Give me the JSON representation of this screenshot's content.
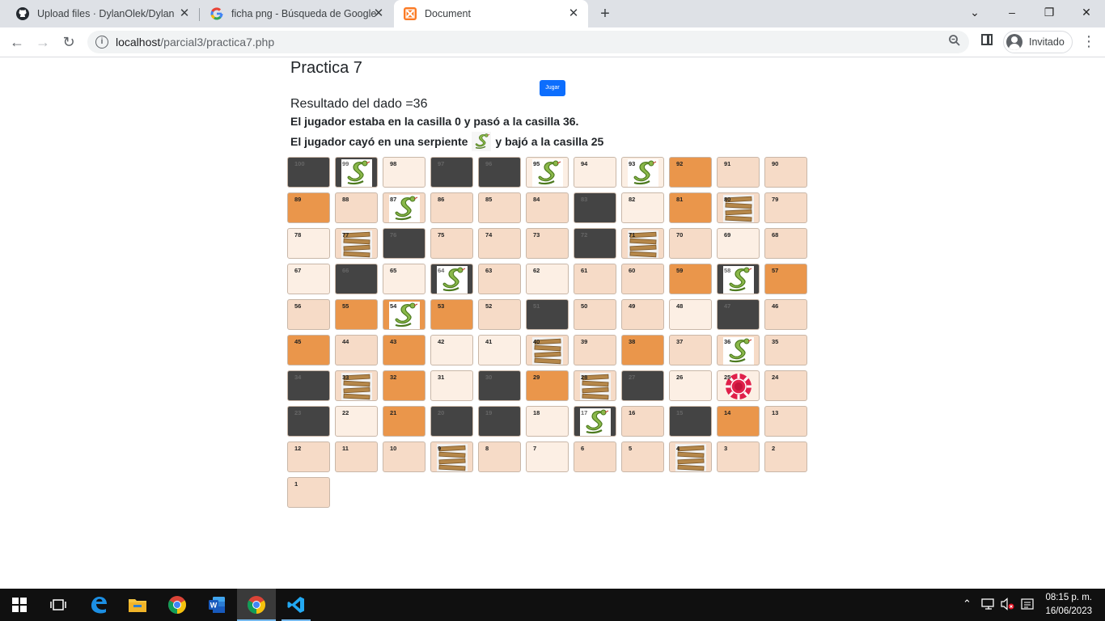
{
  "browser": {
    "tabs": [
      {
        "title": "Upload files · DylanOlek/DylanOl",
        "icon": "github-icon"
      },
      {
        "title": "ficha png - Búsqueda de Google",
        "icon": "google-icon"
      },
      {
        "title": "Document",
        "icon": "xampp-icon",
        "active": true
      }
    ],
    "url_host": "localhost",
    "url_path": "/parcial3/practica7.php",
    "profile_label": "Invitado"
  },
  "page": {
    "title": "Practica 7",
    "play_label": "Jugar",
    "dice_result": "Resultado del dado =36",
    "move_text": "El jugador estaba en la casilla 0 y pasó a la casilla 36.",
    "snake_text_before": "El jugador cayó en una serpiente",
    "snake_text_after": "y bajó a la casilla 25"
  },
  "board": {
    "colors": {
      "light": "#fcefe4",
      "mid": "#f6dbc7",
      "orange": "#ea964b",
      "dark": "#444444"
    },
    "rows": [
      [
        [
          100,
          "dark",
          ""
        ],
        [
          99,
          "dark",
          "snake"
        ],
        [
          98,
          "light",
          ""
        ],
        [
          97,
          "dark",
          ""
        ],
        [
          96,
          "dark",
          ""
        ],
        [
          95,
          "light",
          "snake"
        ],
        [
          94,
          "light",
          ""
        ],
        [
          93,
          "light",
          "snake"
        ],
        [
          92,
          "orange",
          ""
        ],
        [
          91,
          "mid",
          ""
        ],
        [
          90,
          "mid",
          ""
        ]
      ],
      [
        [
          89,
          "orange",
          ""
        ],
        [
          88,
          "mid",
          ""
        ],
        [
          87,
          "mid",
          "snake"
        ],
        [
          86,
          "mid",
          ""
        ],
        [
          85,
          "mid",
          ""
        ],
        [
          84,
          "mid",
          ""
        ],
        [
          83,
          "dark",
          ""
        ],
        [
          82,
          "light",
          ""
        ],
        [
          81,
          "orange",
          ""
        ],
        [
          80,
          "mid",
          "ladder"
        ],
        [
          79,
          "mid",
          ""
        ]
      ],
      [
        [
          78,
          "light",
          ""
        ],
        [
          77,
          "mid",
          "ladder"
        ],
        [
          76,
          "dark",
          ""
        ],
        [
          75,
          "mid",
          ""
        ],
        [
          74,
          "mid",
          ""
        ],
        [
          73,
          "mid",
          ""
        ],
        [
          72,
          "dark",
          ""
        ],
        [
          71,
          "mid",
          "ladder"
        ],
        [
          70,
          "mid",
          ""
        ],
        [
          69,
          "light",
          ""
        ],
        [
          68,
          "mid",
          ""
        ]
      ],
      [
        [
          67,
          "light",
          ""
        ],
        [
          66,
          "dark",
          ""
        ],
        [
          65,
          "light",
          ""
        ],
        [
          64,
          "dark",
          "snake"
        ],
        [
          63,
          "mid",
          ""
        ],
        [
          62,
          "light",
          ""
        ],
        [
          61,
          "mid",
          ""
        ],
        [
          60,
          "mid",
          ""
        ],
        [
          59,
          "orange",
          ""
        ],
        [
          58,
          "dark",
          "snake"
        ],
        [
          57,
          "orange",
          ""
        ]
      ],
      [
        [
          56,
          "mid",
          ""
        ],
        [
          55,
          "orange",
          ""
        ],
        [
          54,
          "orange",
          "snake"
        ],
        [
          53,
          "orange",
          ""
        ],
        [
          52,
          "mid",
          ""
        ],
        [
          51,
          "dark",
          ""
        ],
        [
          50,
          "mid",
          ""
        ],
        [
          49,
          "mid",
          ""
        ],
        [
          48,
          "light",
          ""
        ],
        [
          47,
          "dark",
          ""
        ],
        [
          46,
          "mid",
          ""
        ]
      ],
      [
        [
          45,
          "orange",
          ""
        ],
        [
          44,
          "mid",
          ""
        ],
        [
          43,
          "orange",
          ""
        ],
        [
          42,
          "light",
          ""
        ],
        [
          41,
          "light",
          ""
        ],
        [
          40,
          "mid",
          "ladder"
        ],
        [
          39,
          "mid",
          ""
        ],
        [
          38,
          "orange",
          ""
        ],
        [
          37,
          "mid",
          ""
        ],
        [
          36,
          "mid",
          "snake"
        ],
        [
          35,
          "mid",
          ""
        ]
      ],
      [
        [
          34,
          "dark",
          ""
        ],
        [
          33,
          "mid",
          "ladder"
        ],
        [
          32,
          "orange",
          ""
        ],
        [
          31,
          "light",
          ""
        ],
        [
          30,
          "dark",
          ""
        ],
        [
          29,
          "orange",
          ""
        ],
        [
          28,
          "mid",
          "ladder"
        ],
        [
          27,
          "dark",
          ""
        ],
        [
          26,
          "light",
          ""
        ],
        [
          25,
          "light",
          "chip"
        ],
        [
          24,
          "mid",
          ""
        ]
      ],
      [
        [
          23,
          "dark",
          ""
        ],
        [
          22,
          "light",
          ""
        ],
        [
          21,
          "orange",
          ""
        ],
        [
          20,
          "dark",
          ""
        ],
        [
          19,
          "dark",
          ""
        ],
        [
          18,
          "light",
          ""
        ],
        [
          17,
          "dark",
          "snake"
        ],
        [
          16,
          "mid",
          ""
        ],
        [
          15,
          "dark",
          ""
        ],
        [
          14,
          "orange",
          ""
        ],
        [
          13,
          "mid",
          ""
        ]
      ],
      [
        [
          12,
          "mid",
          ""
        ],
        [
          11,
          "mid",
          ""
        ],
        [
          10,
          "mid",
          ""
        ],
        [
          9,
          "mid",
          "ladder"
        ],
        [
          8,
          "mid",
          ""
        ],
        [
          7,
          "light",
          ""
        ],
        [
          6,
          "mid",
          ""
        ],
        [
          5,
          "mid",
          ""
        ],
        [
          4,
          "mid",
          "ladder"
        ],
        [
          3,
          "mid",
          ""
        ],
        [
          2,
          "mid",
          ""
        ]
      ],
      [
        [
          1,
          "mid",
          ""
        ]
      ]
    ]
  },
  "taskbar": {
    "time": "08:15 p. m.",
    "date": "16/06/2023"
  }
}
